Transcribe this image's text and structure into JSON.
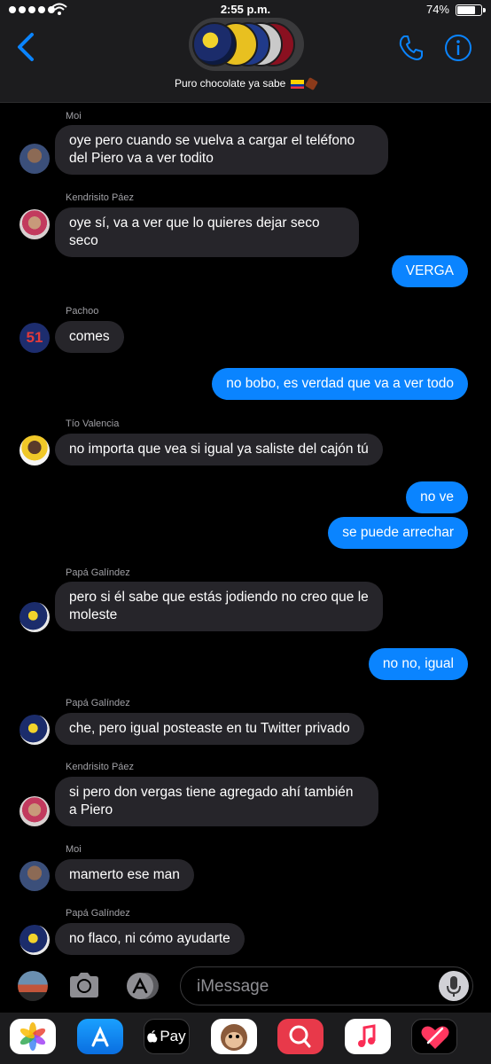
{
  "status": {
    "time": "2:55 p.m.",
    "battery": "74%"
  },
  "header": {
    "title": "Puro chocolate ya sabe"
  },
  "messages": [
    {
      "from": "Moi",
      "text": "oye pero cuando se vuelva a cargar el teléfono del Piero va a ver todito"
    },
    {
      "from": "Kendrisito Páez",
      "text": "oye sí, va a ver que lo quieres dejar seco seco"
    },
    {
      "from": "",
      "text": "VERGA"
    },
    {
      "from": "Pachoo",
      "text": "comes"
    },
    {
      "from": "",
      "text": "no bobo, es verdad que va a ver todo"
    },
    {
      "from": "Tío Valencia",
      "text": "no importa que vea si igual ya saliste del cajón tú"
    },
    {
      "from": "",
      "text": "no ve"
    },
    {
      "from": "",
      "text": "se puede arrechar"
    },
    {
      "from": "Papá Galíndez",
      "text": "pero si él sabe que estás jodiendo no creo que le moleste"
    },
    {
      "from": "",
      "text": "no no, igual"
    },
    {
      "from": "Papá Galíndez",
      "text": "che, pero igual posteaste en tu Twitter privado"
    },
    {
      "from": "Kendrisito Páez",
      "text": "si pero don vergas tiene agregado ahí también a Piero"
    },
    {
      "from": "Moi",
      "text": "mamerto ese man"
    },
    {
      "from": "Papá Galíndez",
      "text": "no flaco, ni cómo ayudarte"
    }
  ],
  "input": {
    "placeholder": "iMessage"
  },
  "apps": {
    "pay_label": "Pay"
  },
  "avatar_numbers": {
    "pachoo": "51"
  },
  "colors": {
    "outgoing": "#0a84ff",
    "incoming": "#26252a",
    "accent": "#0a84ff"
  },
  "icons": [
    "back-chevron-icon",
    "phone-icon",
    "info-icon",
    "camera-icon",
    "app-store-icon",
    "microphone-icon",
    "photos-app-icon",
    "apple-pay-icon",
    "animoji-icon",
    "search-images-icon",
    "music-icon",
    "digital-touch-icon"
  ]
}
